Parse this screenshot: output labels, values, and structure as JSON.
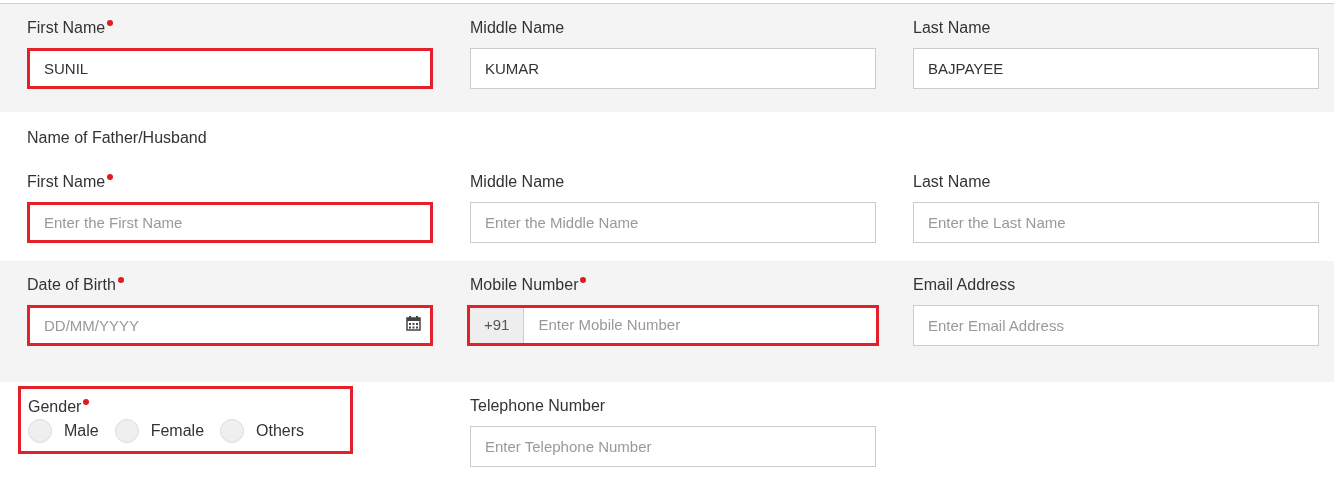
{
  "sections": [
    {
      "fields": [
        {
          "kind": "text",
          "label": "First Name",
          "required": true,
          "highlighted": true,
          "value": "SUNIL"
        },
        {
          "kind": "text",
          "label": "Middle Name",
          "required": false,
          "highlighted": false,
          "value": "KUMAR"
        },
        {
          "kind": "text",
          "label": "Last Name",
          "required": false,
          "highlighted": false,
          "value": "BAJPAYEE"
        }
      ]
    },
    {
      "heading": "Name of Father/Husband",
      "fields": [
        {
          "kind": "text",
          "label": "First Name",
          "required": true,
          "highlighted": true,
          "placeholder": "Enter the First Name"
        },
        {
          "kind": "text",
          "label": "Middle Name",
          "required": false,
          "highlighted": false,
          "placeholder": "Enter the Middle Name"
        },
        {
          "kind": "text",
          "label": "Last Name",
          "required": false,
          "highlighted": false,
          "placeholder": "Enter the Last Name"
        }
      ]
    },
    {
      "fields": [
        {
          "kind": "date",
          "label": "Date of Birth",
          "required": true,
          "highlighted": true,
          "placeholder": "DD/MM/YYYY"
        },
        {
          "kind": "phone",
          "label": "Mobile Number",
          "required": true,
          "highlighted": true,
          "prefix": "+91",
          "placeholder": "Enter Mobile Number"
        },
        {
          "kind": "text",
          "label": "Email Address",
          "required": false,
          "highlighted": false,
          "placeholder": "Enter Email Address"
        }
      ]
    },
    {
      "fields": [
        {
          "kind": "radio",
          "label": "Gender",
          "required": true,
          "highlighted": true,
          "options": [
            {
              "label": "Male",
              "selected": false
            },
            {
              "label": "Female",
              "selected": false
            },
            {
              "label": "Others",
              "selected": false
            }
          ]
        },
        {
          "kind": "text",
          "label": "Telephone Number",
          "required": false,
          "highlighted": false,
          "placeholder": "Enter Telephone Number"
        }
      ]
    }
  ]
}
